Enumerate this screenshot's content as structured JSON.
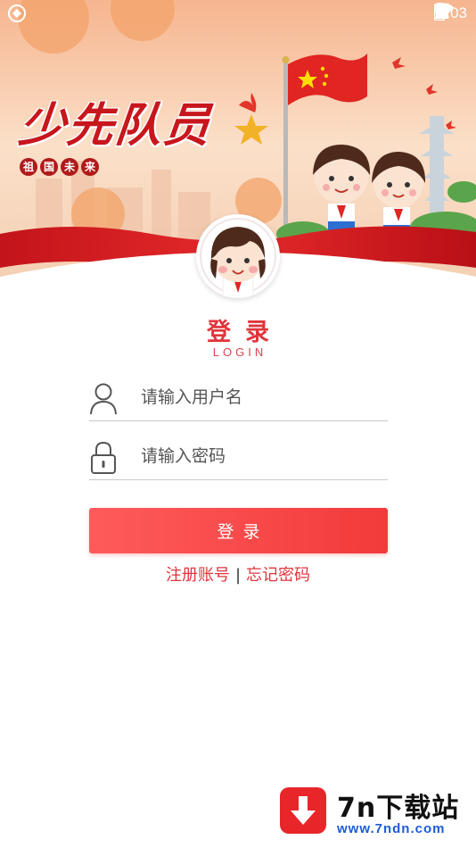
{
  "status_bar": {
    "time": "5:03",
    "icons": [
      "app-logo-icon",
      "location-icon",
      "wifi-icon",
      "signal-icon",
      "battery-icon"
    ]
  },
  "hero": {
    "title": "少先队员",
    "subtitle_chars": [
      "祖",
      "国",
      "未",
      "来"
    ]
  },
  "login": {
    "title": "登录",
    "subtitle": "LOGIN",
    "username_placeholder": "请输入用户名",
    "password_placeholder": "请输入密码",
    "submit_label": "登录",
    "register_link": "注册账号",
    "separator": "|",
    "forgot_link": "忘记密码"
  },
  "watermark": {
    "title": "7n下载站",
    "url": "www.7ndn.com"
  },
  "colors": {
    "brand_red": "#e0353c",
    "button_red": "#f23a3a",
    "watermark_blue": "#1e5bd8"
  }
}
